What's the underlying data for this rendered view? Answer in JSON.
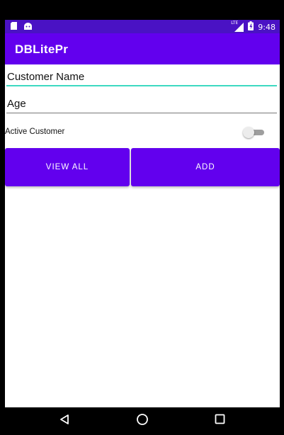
{
  "status_bar": {
    "time": "9:48",
    "network_label": "LTE",
    "left_icons": [
      "sd-card-icon",
      "android-icon"
    ],
    "right_icons": [
      "signal-icon",
      "battery-icon"
    ]
  },
  "app_bar": {
    "title": "DBLitePr"
  },
  "form": {
    "customer_name": {
      "value": "Customer Name"
    },
    "age": {
      "value": "Age"
    },
    "active_toggle": {
      "label": "Active Customer",
      "checked": false
    }
  },
  "buttons": {
    "view_all": "VIEW ALL",
    "add": "ADD"
  },
  "nav_bar": {
    "icons": [
      "back-icon",
      "home-icon",
      "recents-icon"
    ]
  },
  "colors": {
    "primary": "#6200ee",
    "primary_dark": "#4a12c4",
    "accent": "#3dd9c1"
  }
}
